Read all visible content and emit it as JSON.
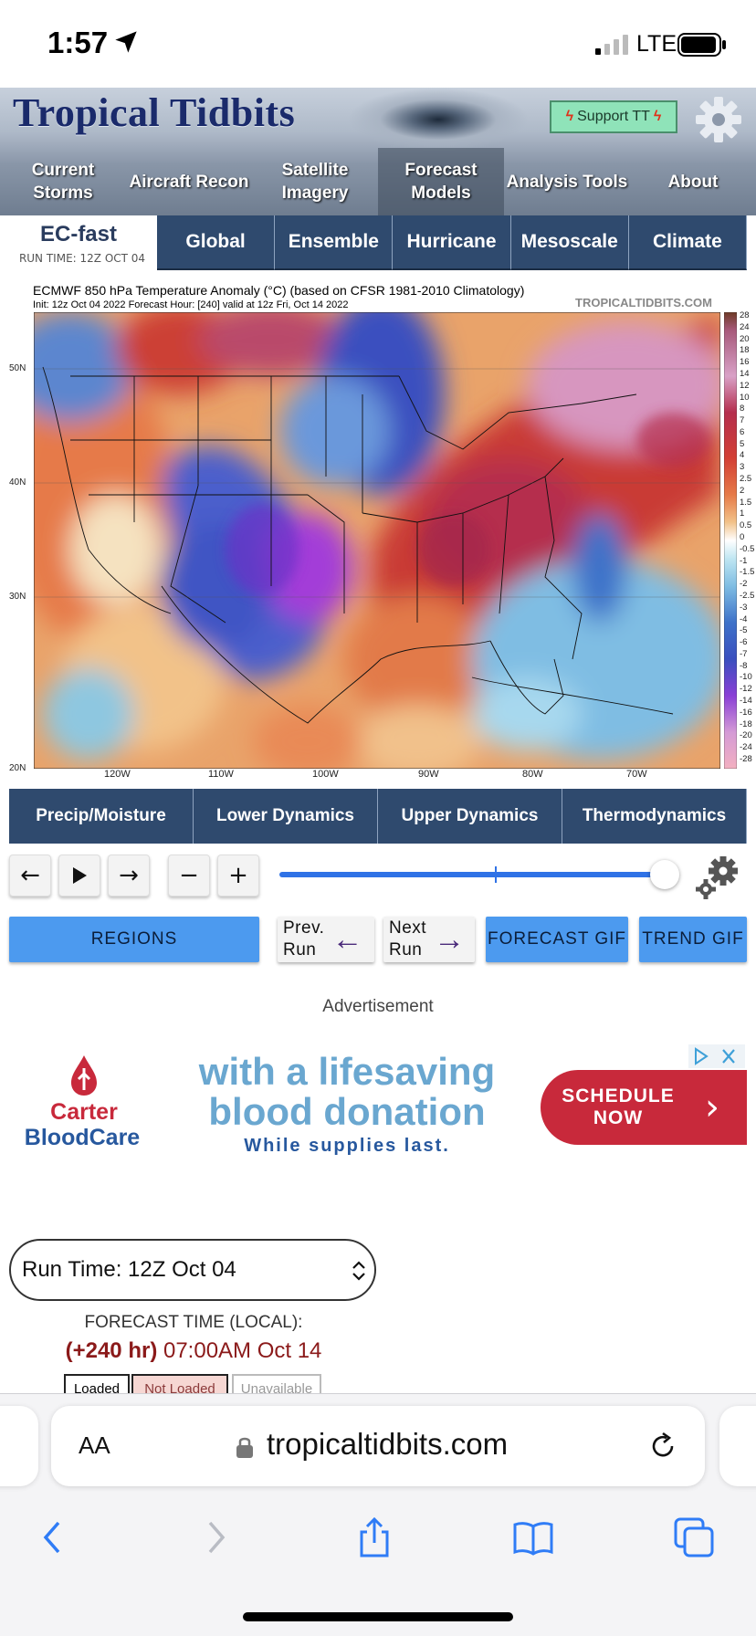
{
  "status": {
    "time": "1:57",
    "network": "LTE"
  },
  "site": {
    "logo": "Tropical Tidbits",
    "support_label": "Support TT",
    "nav": [
      {
        "label": "Current Storms"
      },
      {
        "label": "Aircraft Recon"
      },
      {
        "label": "Satellite Imagery"
      },
      {
        "label": "Forecast Models",
        "active": true
      },
      {
        "label": "Analysis Tools"
      },
      {
        "label": "About"
      }
    ]
  },
  "model": {
    "name": "EC-fast",
    "run_time": "RUN TIME: 12Z OCT 04",
    "tabs": [
      "Global",
      "Ensemble",
      "Hurricane",
      "Mesoscale",
      "Climate"
    ]
  },
  "map": {
    "title": "ECMWF 850 hPa Temperature Anomaly (°C) (based on CFSR 1981-2010 Climatology)",
    "subtitle": "Init: 12z Oct 04 2022   Forecast Hour: [240]   valid at 12z Fri, Oct 14 2022",
    "site": "TROPICALTIDBITS.COM",
    "lat_labels": [
      "50N",
      "40N",
      "30N",
      "20N"
    ],
    "lon_labels": [
      "120W",
      "110W",
      "100W",
      "90W",
      "80W",
      "70W"
    ],
    "colorbar_labels": [
      "28",
      "24",
      "20",
      "18",
      "16",
      "14",
      "12",
      "10",
      "8",
      "7",
      "6",
      "5",
      "4",
      "3",
      "2.5",
      "2",
      "1.5",
      "1",
      "0.5",
      "0",
      "-0.5",
      "-1",
      "-1.5",
      "-2",
      "-2.5",
      "-3",
      "-4",
      "-5",
      "-6",
      "-7",
      "-8",
      "-10",
      "-12",
      "-14",
      "-16",
      "-18",
      "-20",
      "-24",
      "-28"
    ]
  },
  "categories": [
    "Precip/Moisture",
    "Lower Dynamics",
    "Upper Dynamics",
    "Thermodynamics"
  ],
  "controls": {
    "regions": "REGIONS",
    "prev_run": [
      "Prev.",
      "Run"
    ],
    "next_run": [
      "Next",
      "Run"
    ],
    "forecast_gif": "FORECAST GIF",
    "trend_gif": "TREND GIF",
    "slider_value_fraction": 1.0
  },
  "ad": {
    "label": "Advertisement",
    "brand_1": "Carter",
    "brand_2": "BloodCare",
    "headline_1": "with a lifesaving",
    "headline_2": "blood donation",
    "sub": "While supplies last.",
    "cta_1": "SCHEDULE",
    "cta_2": "NOW"
  },
  "run_select": {
    "value": "Run Time: 12Z Oct 04"
  },
  "forecast": {
    "label": "FORECAST TIME (LOCAL):",
    "hour": "(+240 hr)",
    "time": " 07:00AM Oct 14"
  },
  "legend": [
    "Loaded",
    "Not Loaded",
    "Unavailable"
  ],
  "browser": {
    "aa": "AA",
    "url": "tropicaltidbits.com"
  }
}
